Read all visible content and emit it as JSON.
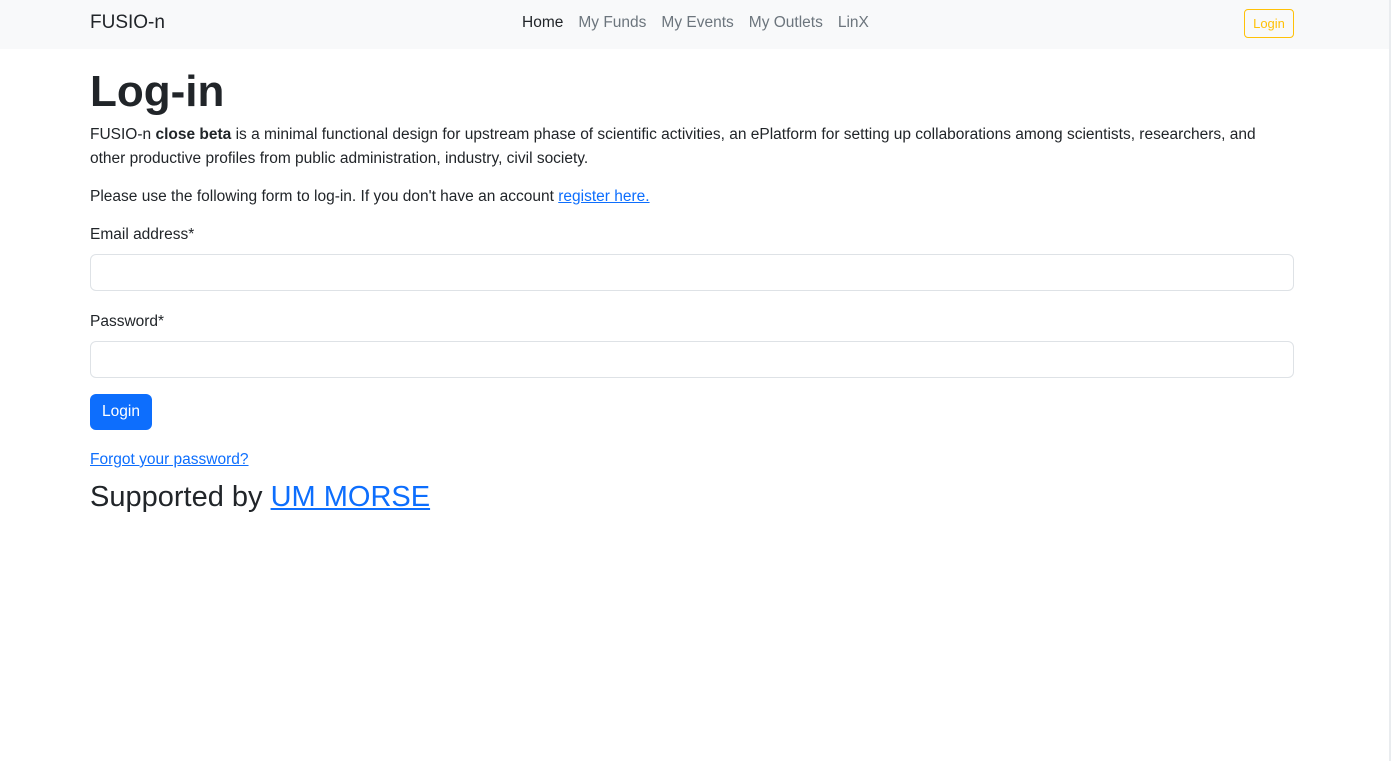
{
  "navbar": {
    "brand": "FUSIO-n",
    "links": [
      {
        "label": "Home",
        "active": true
      },
      {
        "label": "My Funds",
        "active": false
      },
      {
        "label": "My Events",
        "active": false
      },
      {
        "label": "My Outlets",
        "active": false
      },
      {
        "label": "LinX",
        "active": false
      }
    ],
    "login_label": "Login"
  },
  "main": {
    "title": "Log-in",
    "intro_prefix": "FUSIO-n ",
    "intro_strong": "close beta",
    "intro_rest": " is a minimal functional design for upstream phase of scientific activities, an ePlatform for setting up collaborations among scientists, researchers, and other productive profiles from public administration, industry, civil society.",
    "form_note": "Please use the following form to log-in. If you don't have an account ",
    "register_link": "register here.",
    "email_label": "Email address*",
    "email_value": "",
    "password_label": "Password*",
    "password_value": "",
    "login_button": "Login",
    "forgot_link": "Forgot your password?",
    "supported_prefix": "Supported by ",
    "supported_link": "UM MORSE"
  },
  "colors": {
    "primary": "#0d6efd",
    "warning": "#ffc107",
    "navbar_bg": "#f8f9fa",
    "text": "#212529",
    "muted": "#6c757d"
  }
}
